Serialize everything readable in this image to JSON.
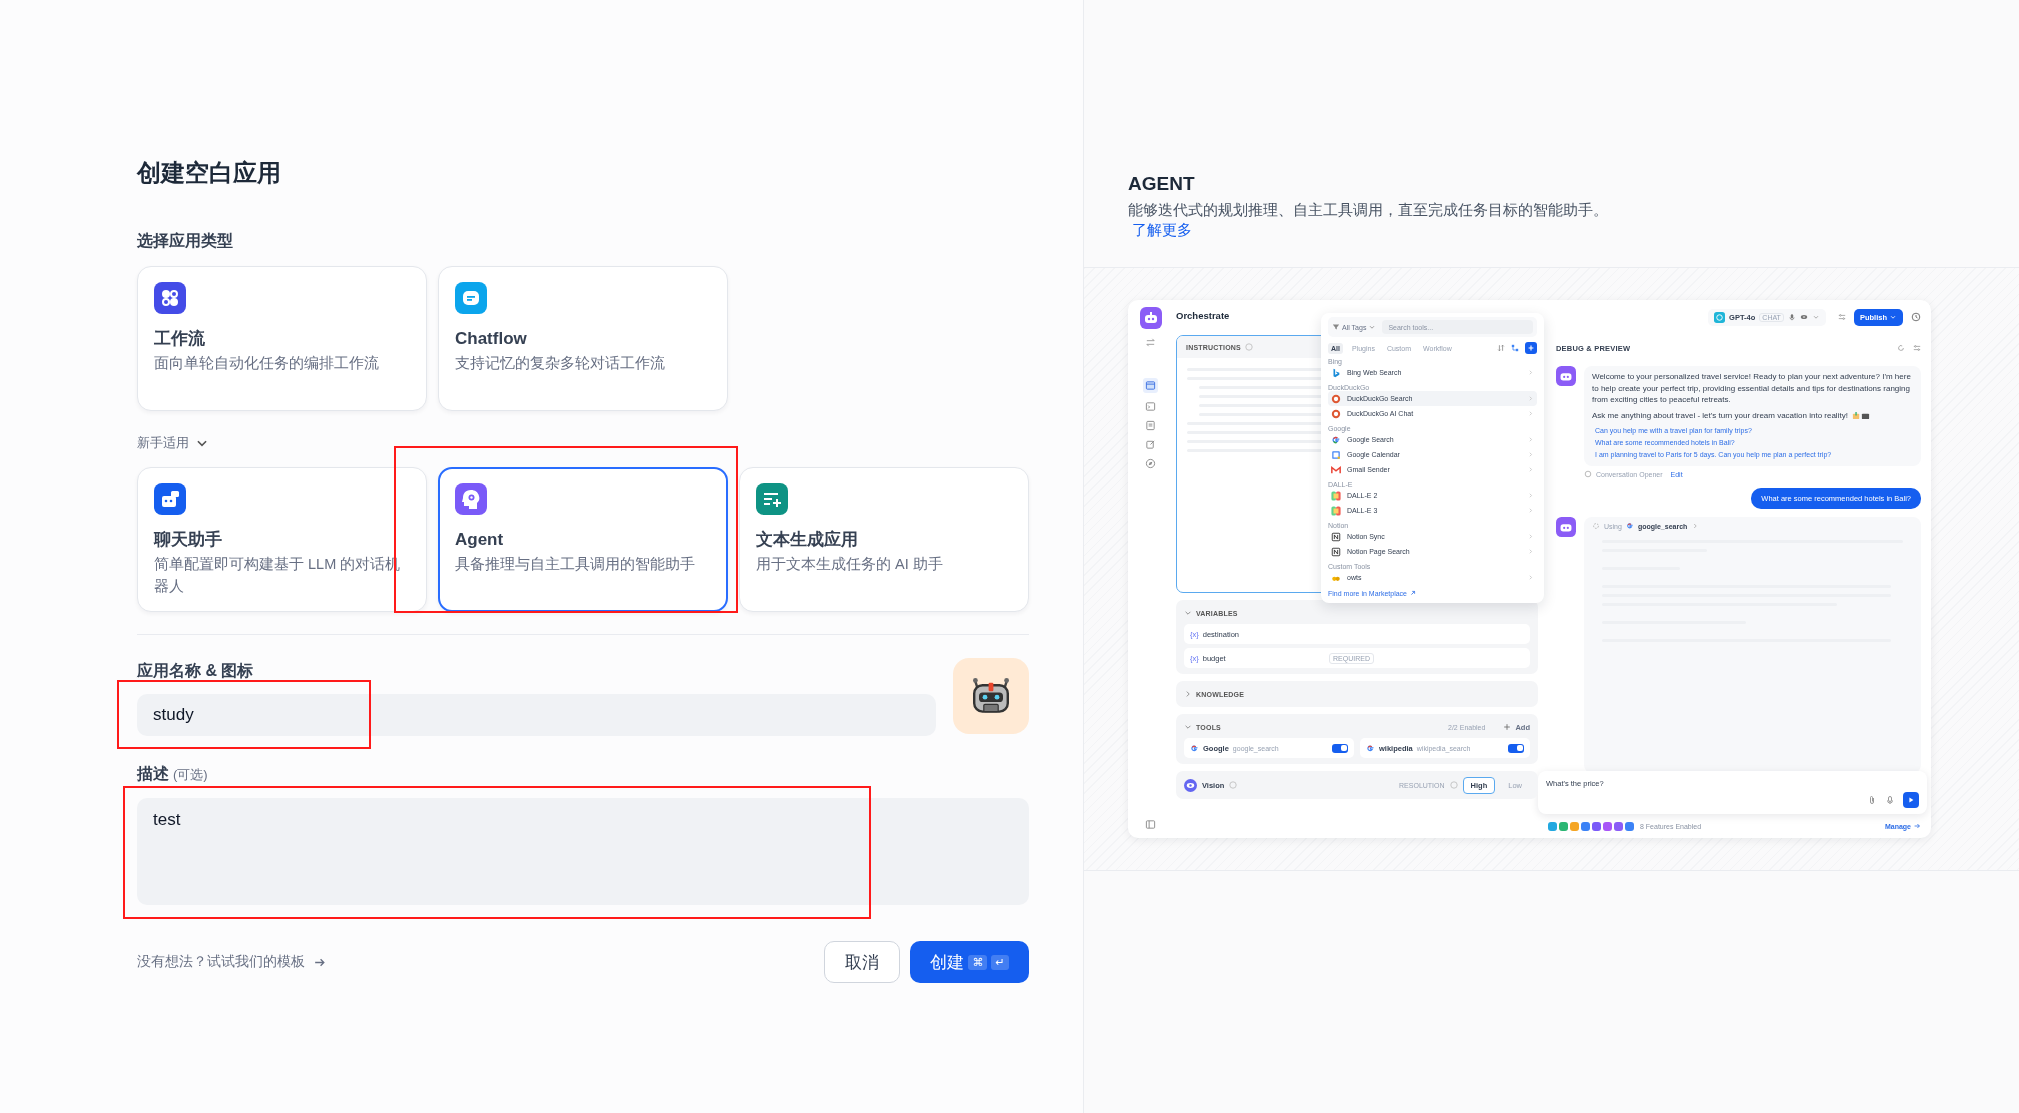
{
  "title": "创建空白应用",
  "type_label": "选择应用类型",
  "app_types": [
    {
      "kind": "workflow",
      "title": "工作流",
      "description": "面向单轮自动化任务的编排工作流",
      "selected": false,
      "highlighted": false
    },
    {
      "kind": "chatflow",
      "title": "Chatflow",
      "description": "支持记忆的复杂多轮对话工作流",
      "selected": false,
      "highlighted": false
    }
  ],
  "beginner": {
    "label": "新手适用",
    "expanded": true,
    "types": [
      {
        "kind": "chat",
        "title": "聊天助手",
        "description": "简单配置即可构建基于 LLM 的对话机器人",
        "selected": false,
        "highlighted": false
      },
      {
        "kind": "agent",
        "title": "Agent",
        "description": "具备推理与自主工具调用的智能助手",
        "selected": true,
        "highlighted": true
      },
      {
        "kind": "completion",
        "title": "文本生成应用",
        "description": "用于文本生成任务的 AI 助手",
        "selected": false,
        "highlighted": false
      }
    ]
  },
  "name_field": {
    "label": "应用名称 & 图标",
    "value": "study",
    "highlighted": true
  },
  "description_field": {
    "label": "描述",
    "hint": "(可选)",
    "value": "test",
    "highlighted": true
  },
  "template_link": "没有想法？试试我们的模板",
  "cancel_button": "取消",
  "create_button": {
    "label": "创建",
    "keys": [
      "⌘",
      "↵"
    ]
  },
  "preview": {
    "title": "AGENT",
    "description": "能够迭代式的规划推理、自主工具调用，直至完成任务目标的智能助手。",
    "link": "了解更多",
    "app": {
      "heading": "Orchestrate",
      "instructions_label": "INSTRUCTIONS",
      "tool_picker": {
        "tag_filter": "All Tags",
        "search_placeholder": "Search tools...",
        "tabs": [
          {
            "label": "All",
            "selected": true
          },
          {
            "label": "Plugins",
            "selected": false
          },
          {
            "label": "Custom",
            "selected": false
          },
          {
            "label": "Workflow",
            "selected": false
          }
        ],
        "groups": [
          {
            "label": "Bing",
            "tools": [
              {
                "kind": "bing",
                "name": "Bing Web Search",
                "selected": false
              }
            ]
          },
          {
            "label": "DuckDuckGo",
            "tools": [
              {
                "kind": "duckduckgo",
                "name": "DuckDuckGo Search",
                "selected": true
              },
              {
                "kind": "duckduckgo",
                "name": "DuckDuckGo AI Chat",
                "selected": false
              }
            ]
          },
          {
            "label": "Google",
            "tools": [
              {
                "kind": "google",
                "name": "Google Search",
                "selected": false
              },
              {
                "kind": "calendar",
                "name": "Google Calendar",
                "selected": false
              },
              {
                "kind": "gmail",
                "name": "Gmail Sender",
                "selected": false
              }
            ]
          },
          {
            "label": "DALL-E",
            "tools": [
              {
                "kind": "dalle",
                "name": "DALL-E 2",
                "selected": false
              },
              {
                "kind": "dalle",
                "name": "DALL-E 3",
                "selected": false
              }
            ]
          },
          {
            "label": "Notion",
            "tools": [
              {
                "kind": "notion",
                "name": "Notion Sync",
                "selected": false
              },
              {
                "kind": "notion",
                "name": "Notion Page Search",
                "selected": false
              }
            ]
          },
          {
            "label": "Custom Tools",
            "tools": [
              {
                "kind": "custom",
                "name": "owts",
                "selected": false
              }
            ]
          }
        ],
        "marketplace_link": "Find more in Marketplace"
      },
      "variables": {
        "label": "VARIABLES",
        "expanded": true,
        "items": [
          {
            "prefix": "{x}",
            "name": "destination"
          },
          {
            "prefix": "{x}",
            "name": "budget",
            "badge": "REQUIRED"
          }
        ]
      },
      "knowledge": {
        "label": "KNOWLEDGE",
        "expanded": false
      },
      "tools": {
        "label": "TOOLS",
        "expanded": true,
        "count": "2/2 Enabled",
        "add": "Add",
        "items": [
          {
            "provider": "Google",
            "name": "google_search",
            "on": true
          },
          {
            "provider": "wikipedia",
            "name": "wikipedia_search",
            "on": true
          }
        ]
      },
      "vision": {
        "label": "Vision",
        "resolution_label": "RESOLUTION",
        "options": [
          {
            "label": "High",
            "selected": true
          },
          {
            "label": "Low",
            "selected": false
          }
        ]
      },
      "model": {
        "name": "GPT-4o",
        "mode": "CHAT"
      },
      "publish": "Publish",
      "debug_title": "DEBUG & PREVIEW",
      "welcome": {
        "paragraphs": [
          "Welcome to your personalized travel service! Ready to plan your next adventure? I'm here to help create your perfect trip, providing essential details and tips for destinations ranging from exciting cities to peaceful retreats.",
          "Ask me anything about travel - let's turn your dream vacation into reality!"
        ],
        "suggestions": [
          "Can you help me with a travel plan for family trips?",
          "What are some recommended hotels in Bali?",
          "I am planning travel to Paris for 5 days. Can you help me plan a perfect trip?"
        ],
        "opener_label": "Conversation Opener",
        "edit": "Edit"
      },
      "user_message": "What are some recommended hotels in Bali?",
      "tool_call": {
        "label": "Using",
        "tool": "google_search"
      },
      "input_value": "What's the price?",
      "features": {
        "label": "8 Features Enabled",
        "manage": "Manage"
      }
    }
  }
}
